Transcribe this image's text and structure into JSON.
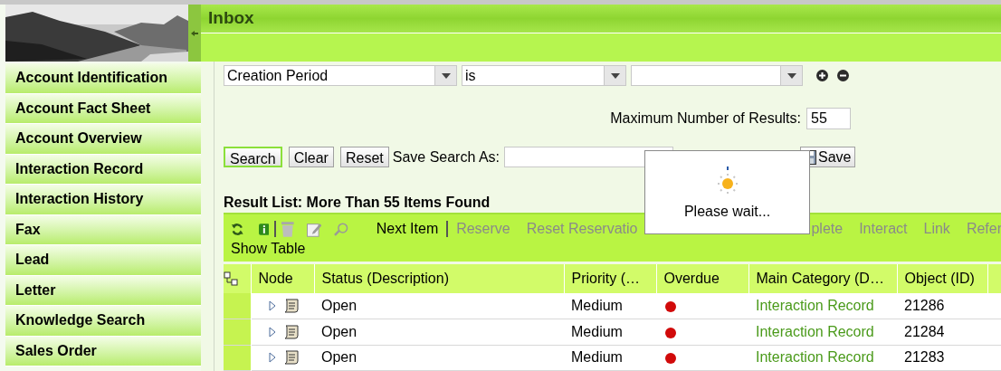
{
  "sidebar": {
    "items": [
      {
        "label": "Account Identification"
      },
      {
        "label": "Account Fact Sheet"
      },
      {
        "label": "Account Overview"
      },
      {
        "label": "Interaction Record"
      },
      {
        "label": "Interaction History"
      },
      {
        "label": "Fax"
      },
      {
        "label": "Lead"
      },
      {
        "label": "Letter"
      },
      {
        "label": "Knowledge Search"
      },
      {
        "label": "Sales Order"
      }
    ]
  },
  "header": {
    "title": "Inbox"
  },
  "search": {
    "criteria": [
      {
        "field": "Creation Period",
        "operator": "is"
      }
    ],
    "max_results": {
      "label": "Maximum Number of Results:",
      "value": "55"
    },
    "buttons": [
      {
        "label": "Search",
        "focused": true
      },
      {
        "label": "Clear",
        "focused": false
      },
      {
        "label": "Reset",
        "focused": false
      }
    ],
    "save_search": {
      "label": "Save Search As:",
      "button": "Save"
    }
  },
  "popup": {
    "message": "Please wait..."
  },
  "result_list": {
    "title": "Result List: More Than 55 Items Found",
    "toolbar": [
      {
        "label": "Next Item",
        "disabled": false
      },
      {
        "label": "Reserve",
        "disabled": true
      },
      {
        "label": "Reset Reservatio",
        "disabled": true
      },
      {
        "label": "plete",
        "disabled": true
      },
      {
        "label": "Interact",
        "disabled": true
      },
      {
        "label": "Link",
        "disabled": true
      },
      {
        "label": "Refer",
        "disabled": true
      }
    ],
    "show_table": "Show Table"
  },
  "table": {
    "columns": [
      "Node",
      "Status (Description)",
      "Priority (…",
      "Overdue",
      "Main Category (D…",
      "Object (ID)"
    ],
    "rows": [
      {
        "status": "Open",
        "priority": "Medium",
        "overdue": true,
        "category": "Interaction Record",
        "object_id": "21286"
      },
      {
        "status": "Open",
        "priority": "Medium",
        "overdue": true,
        "category": "Interaction Record",
        "object_id": "21284"
      },
      {
        "status": "Open",
        "priority": "Medium",
        "overdue": true,
        "category": "Interaction Record",
        "object_id": "21283"
      }
    ]
  }
}
